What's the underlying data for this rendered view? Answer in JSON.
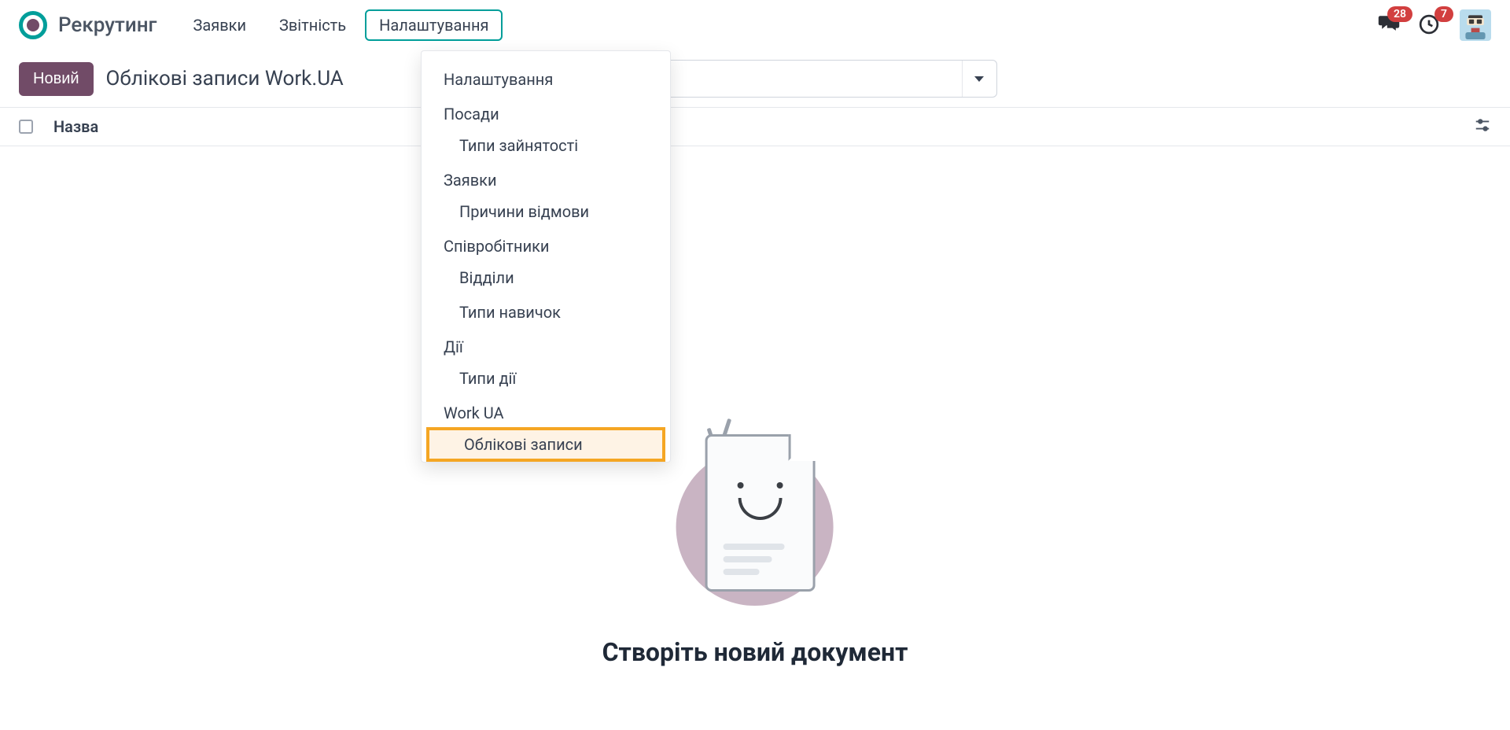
{
  "app_name": "Рекрутинг",
  "nav": {
    "items": [
      "Заявки",
      "Звітність",
      "Налаштування"
    ],
    "active_index": 2
  },
  "notifications": {
    "chat_count": "28",
    "activity_count": "7"
  },
  "control": {
    "new_button": "Новий",
    "breadcrumb": "Облікові записи Work.UA"
  },
  "table": {
    "columns": {
      "name": "Назва"
    }
  },
  "dropdown": {
    "settings": "Налаштування",
    "positions_section": "Посади",
    "employment_types": "Типи зайнятості",
    "requests_section": "Заявки",
    "refuse_reasons": "Причини відмови",
    "employees_section": "Співробітники",
    "departments": "Відділи",
    "skill_types": "Типи навичок",
    "actions_section": "Дії",
    "action_types": "Типи дії",
    "workua_section": "Work UA",
    "accounts": "Облікові записи"
  },
  "empty_state": {
    "title": "Створіть новий документ"
  }
}
